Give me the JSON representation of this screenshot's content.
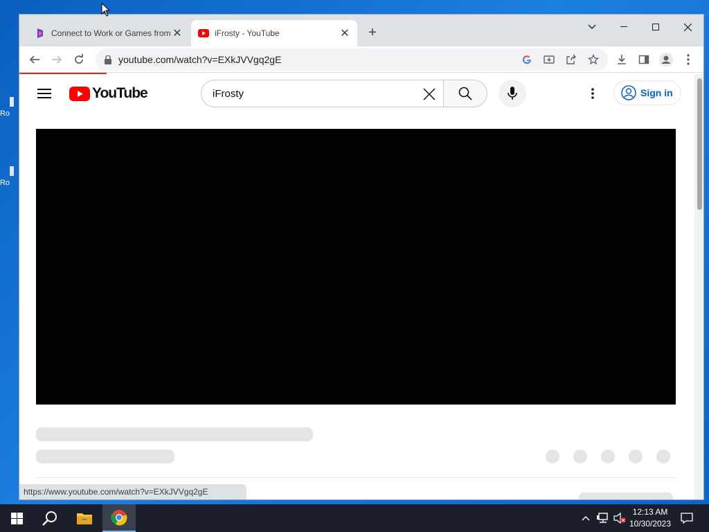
{
  "desktop": {
    "icon_label_1": "Ro",
    "icon_label_2": "Ro"
  },
  "browser": {
    "tabs": [
      {
        "title": "Connect to Work or Games from",
        "active": false
      },
      {
        "title": "iFrosty - YouTube",
        "active": true
      }
    ],
    "url": "youtube.com/watch?v=EXkJVVgq2gE",
    "status_url": "https://www.youtube.com/watch?v=EXkJVVgq2gE"
  },
  "youtube": {
    "logo_text": "YouTube",
    "search_value": "iFrosty",
    "signin_label": "Sign in"
  },
  "taskbar": {
    "time": "12:13 AM",
    "date": "10/30/2023"
  },
  "colors": {
    "youtube_red": "#ff0000",
    "signin_blue": "#065fd4",
    "load_bar": "#d93025"
  }
}
